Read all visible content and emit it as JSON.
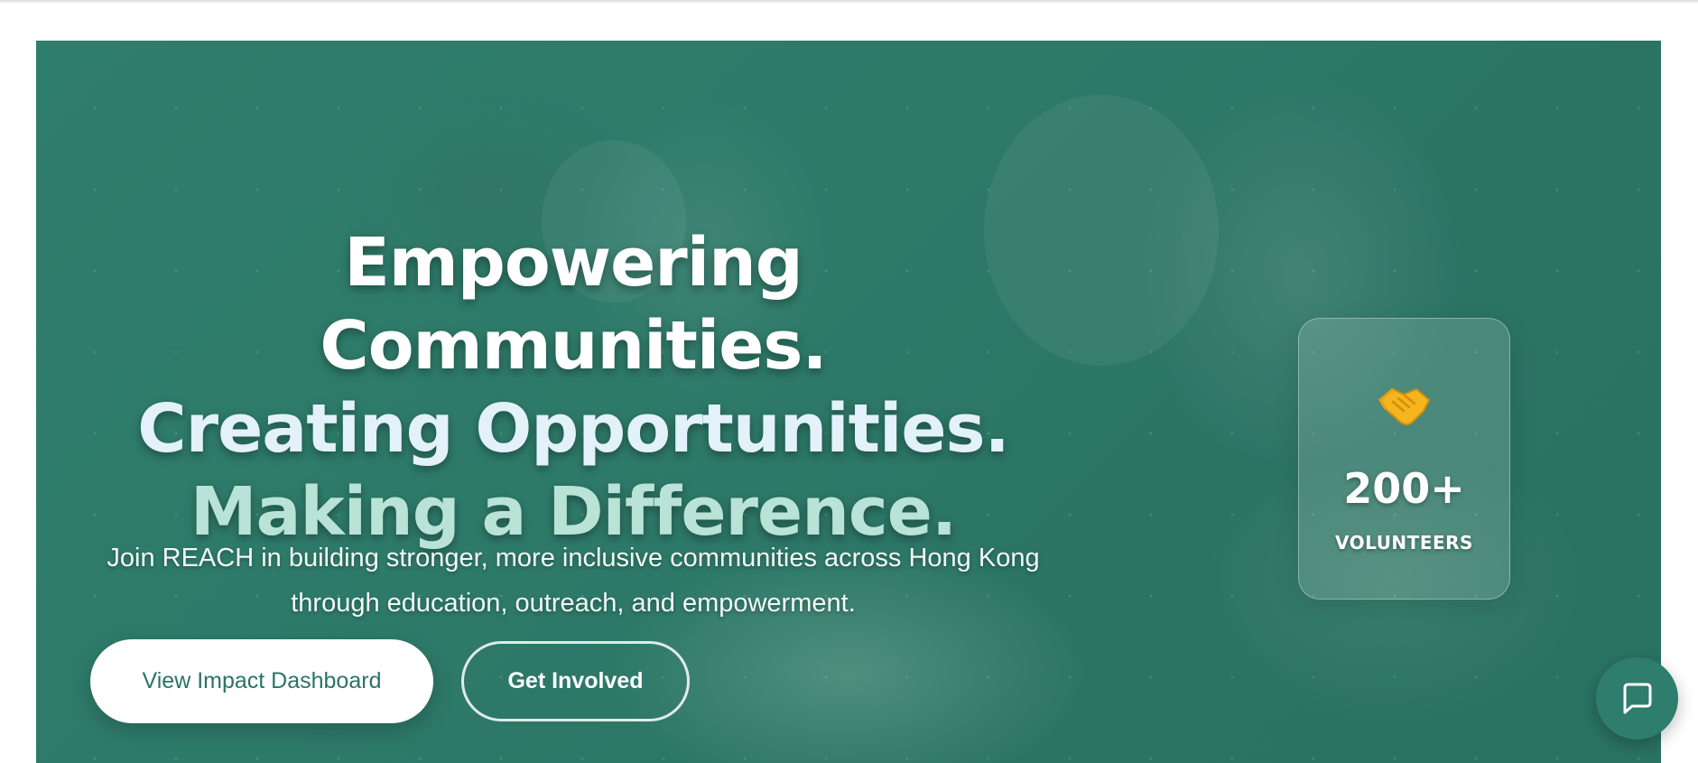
{
  "hero": {
    "headline": {
      "line1": "Empowering Communities.",
      "line2": "Creating Opportunities.",
      "line3": "Making a Difference."
    },
    "subtitle_line1": "Join REACH in building stronger, more inclusive communities across Hong Kong",
    "subtitle_line2": "through education, outreach, and empowerment.",
    "primary_button_label": "View Impact Dashboard",
    "secondary_button_label": "Get Involved"
  },
  "stat_card": {
    "icon": "handshake-icon",
    "value": "200+",
    "label": "VOLUNTEERS"
  },
  "chat": {
    "icon": "chat-bubble-icon"
  },
  "colors": {
    "brand_teal": "#2b7464",
    "overlay_teal": "#2f7d6c",
    "headline_white": "#ffffff",
    "headline_light_blue": "#e3f1fb",
    "headline_mint": "#b9e3d6"
  }
}
